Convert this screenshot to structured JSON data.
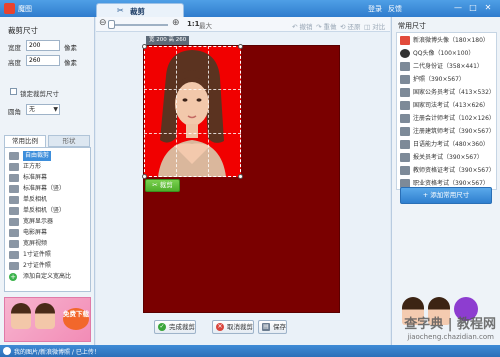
{
  "window": {
    "app_name": "魔图",
    "tab_label": "裁剪",
    "login": "登录",
    "feedback": "反馈",
    "controls": [
      "—",
      "□",
      "✕"
    ]
  },
  "left": {
    "title": "裁剪尺寸",
    "width_label": "宽度",
    "width_value": "200",
    "height_label": "高度",
    "height_value": "260",
    "unit": "像素",
    "lock_label": "锁定裁剪尺寸",
    "corner_label": "圆角",
    "corner_value": "无",
    "tabs": [
      "常用比例",
      "形状"
    ],
    "presets": [
      {
        "label": "自由裁剪",
        "icon": "free-crop",
        "selected": true
      },
      {
        "label": "正方形",
        "icon": "square"
      },
      {
        "label": "标准屏幕",
        "icon": "screen"
      },
      {
        "label": "标准屏幕（竖）",
        "icon": "screen-vertical"
      },
      {
        "label": "单反相机",
        "icon": "camera"
      },
      {
        "label": "单反相机（竖）",
        "icon": "camera-vertical"
      },
      {
        "label": "宽屏显示器",
        "icon": "widescreen"
      },
      {
        "label": "电影屏幕",
        "icon": "movie"
      },
      {
        "label": "宽屏视频",
        "icon": "wide-video"
      },
      {
        "label": "1寸证件照",
        "icon": "id-1"
      },
      {
        "label": "2寸证件照",
        "icon": "id-2"
      },
      {
        "label": "添加自定义宽高比",
        "icon": "plus"
      }
    ],
    "ad_badge": "免费下载"
  },
  "toolbar": {
    "zoom_ratio": "1:1",
    "zoom_max": "最大",
    "undo": "撤销",
    "redo": "重做",
    "reset": "还原",
    "compare": "对比"
  },
  "canvas": {
    "size_tag": "宽 200 高 260",
    "crop_button": "裁剪",
    "photo_bg_color": "#f10000",
    "canvas_color": "#7a0000"
  },
  "actions": {
    "done": "完成裁剪",
    "cancel": "取消裁剪",
    "save": "保存"
  },
  "right": {
    "title": "常用尺寸",
    "sizes": [
      {
        "label": "新浪微博头像（180×180）",
        "icon": "weibo"
      },
      {
        "label": "QQ头像（100×100）",
        "icon": "qq"
      },
      {
        "label": "二代身份证（358×441）",
        "icon": "id-card"
      },
      {
        "label": "护照（390×567）",
        "icon": "passport"
      },
      {
        "label": "国家公务员考试（413×532）",
        "icon": "exam"
      },
      {
        "label": "国家司法考试（413×626）",
        "icon": "exam"
      },
      {
        "label": "注册会计师考试（102×126）",
        "icon": "exam"
      },
      {
        "label": "注册建筑师考试（390×567）",
        "icon": "exam"
      },
      {
        "label": "日语能力考试（480×360）",
        "icon": "exam"
      },
      {
        "label": "报关员考试（390×567）",
        "icon": "exam"
      },
      {
        "label": "教师资格证考试（390×567）",
        "icon": "exam"
      },
      {
        "label": "职业资格考试（390×567）",
        "icon": "exam"
      }
    ],
    "add_button": "+ 添加常用尺寸"
  },
  "status": {
    "text": "我的图片/新浪微博照 / 已上传！",
    "watermark": "查字典 | 教程网",
    "watermark_url": "jiaocheng.chazidian.com"
  }
}
